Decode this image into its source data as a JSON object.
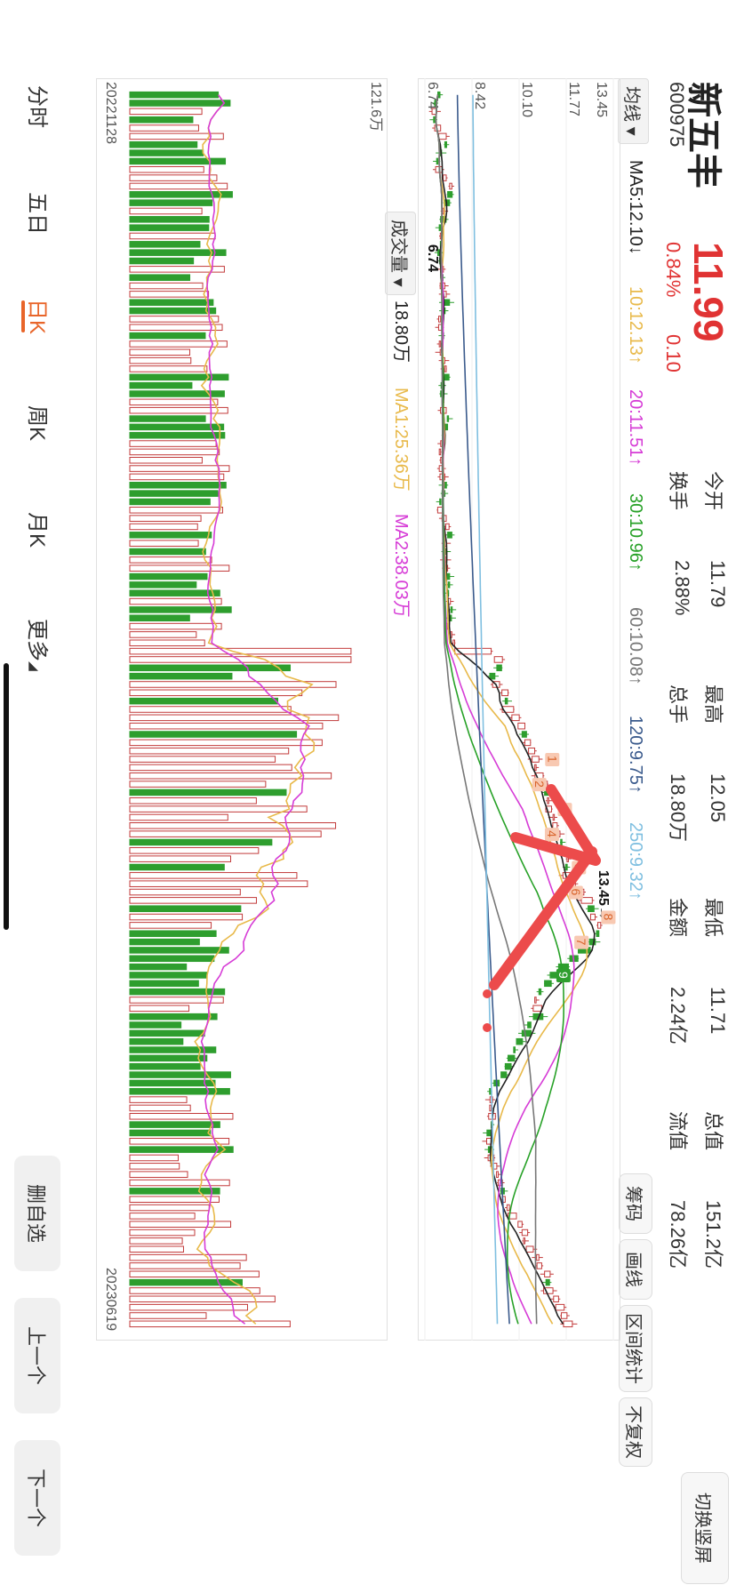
{
  "stock": {
    "name": "新五丰",
    "code": "600975",
    "price": "11.99",
    "change_pct": "0.84%",
    "change": "0.10",
    "stats": [
      {
        "label": "今开",
        "value": "11.79",
        "color": "green"
      },
      {
        "label": "最高",
        "value": "12.05",
        "color": "red"
      },
      {
        "label": "最低",
        "value": "11.71",
        "color": "green"
      },
      {
        "label": "总值",
        "value": "151.2亿",
        "color": "normal"
      },
      {
        "label": "换手",
        "value": "2.88%",
        "color": "normal"
      },
      {
        "label": "总手",
        "value": "18.80万",
        "color": "normal"
      },
      {
        "label": "金额",
        "value": "2.24亿",
        "color": "normal"
      },
      {
        "label": "流值",
        "value": "78.26亿",
        "color": "normal"
      }
    ]
  },
  "toolbar": {
    "switch_label": "切换竖屏",
    "buttons": [
      "筹码",
      "画线",
      "区间统计",
      "不复权"
    ]
  },
  "ma": {
    "selector": "均线",
    "items": [
      {
        "text": "MA5:12.10↓",
        "color": "#222222"
      },
      {
        "text": "10:12.13↑",
        "color": "#e8b94a"
      },
      {
        "text": "20:11.51↑",
        "color": "#d63cd6"
      },
      {
        "text": "30:10.96↑",
        "color": "#27a127"
      },
      {
        "text": "60:10.08↑",
        "color": "#777777"
      },
      {
        "text": "120:9.75↑",
        "color": "#3a5a8c"
      },
      {
        "text": "250:9.32↑",
        "color": "#7fbfe0"
      }
    ]
  },
  "volume": {
    "selector": "成交量",
    "current": "18.80万",
    "ma1": "MA1:25.36万",
    "ma2": "MA2:38.03万",
    "max_label": "121.6万",
    "ma1_color": "#e8b94a",
    "ma2_color": "#d63cd6"
  },
  "price_axis": [
    "13.45",
    "11.77",
    "10.10",
    "8.42",
    "6.74"
  ],
  "dates": {
    "start": "20221128",
    "end": "20230619"
  },
  "annotations": {
    "high_label": "13.45→",
    "low_label": "6.74",
    "wave_numbers": [
      "1",
      "2",
      "3",
      "4",
      "5",
      "6",
      "8",
      "7",
      "9"
    ]
  },
  "bottom_tabs": [
    "分时",
    "五日",
    "日K",
    "周K",
    "月K",
    "更多"
  ],
  "active_tab": "日K",
  "side_buttons": [
    "删自选",
    "上一个",
    "下一个"
  ],
  "colors": {
    "up": "#c23a3a",
    "down": "#2e9e2e",
    "accent": "#e8652a",
    "arrow": "#ec4b4b"
  },
  "chart_data": {
    "type": "candlestick",
    "x": [
      "20221128",
      "20230619"
    ],
    "ylim": [
      6.74,
      13.45
    ],
    "close": [
      7.2,
      7.1,
      7.15,
      7.05,
      7.3,
      7.5,
      7.45,
      7.3,
      7.2,
      7.35,
      7.5,
      7.7,
      7.55,
      7.45,
      7.4,
      7.3,
      7.25,
      7.35,
      7.3,
      7.2,
      7.3,
      7.4,
      7.35,
      7.45,
      7.5,
      7.4,
      7.35,
      7.3,
      7.35,
      7.4,
      7.3,
      7.35,
      7.45,
      7.5,
      7.45,
      7.35,
      7.3,
      7.4,
      7.5,
      7.55,
      7.45,
      7.4,
      7.35,
      7.3,
      7.35,
      7.4,
      7.45,
      7.4,
      7.35,
      7.3,
      7.4,
      7.5,
      7.6,
      7.55,
      7.5,
      7.45,
      7.5,
      7.55,
      7.5,
      7.6,
      7.55,
      7.65,
      7.7,
      7.6,
      7.55,
      7.7,
      7.8,
      9.1,
      9.5,
      9.3,
      9.05,
      9.4,
      9.7,
      9.6,
      9.9,
      10.1,
      10.3,
      10.2,
      10.5,
      10.65,
      10.8,
      10.7,
      10.95,
      11.1,
      11.0,
      11.15,
      11.25,
      11.35,
      11.45,
      11.55,
      11.6,
      11.7,
      11.85,
      11.75,
      11.9,
      12.1,
      12.4,
      12.7,
      12.55,
      12.8,
      13.0,
      12.85,
      12.6,
      12.2,
      11.9,
      11.5,
      11.2,
      11.0,
      10.8,
      10.7,
      10.9,
      10.6,
      10.4,
      10.2,
      10.0,
      9.9,
      9.7,
      9.6,
      9.45,
      9.2,
      9.05,
      9.15,
      9.1,
      9.25,
      9.1,
      8.95,
      9.1,
      9.0,
      9.2,
      9.3,
      9.35,
      9.5,
      9.45,
      9.6,
      9.75,
      10.0,
      10.2,
      10.4,
      10.3,
      10.6,
      10.8,
      10.9,
      11.2,
      11.05,
      11.3,
      11.5,
      11.7,
      11.8,
      11.99
    ]
  }
}
